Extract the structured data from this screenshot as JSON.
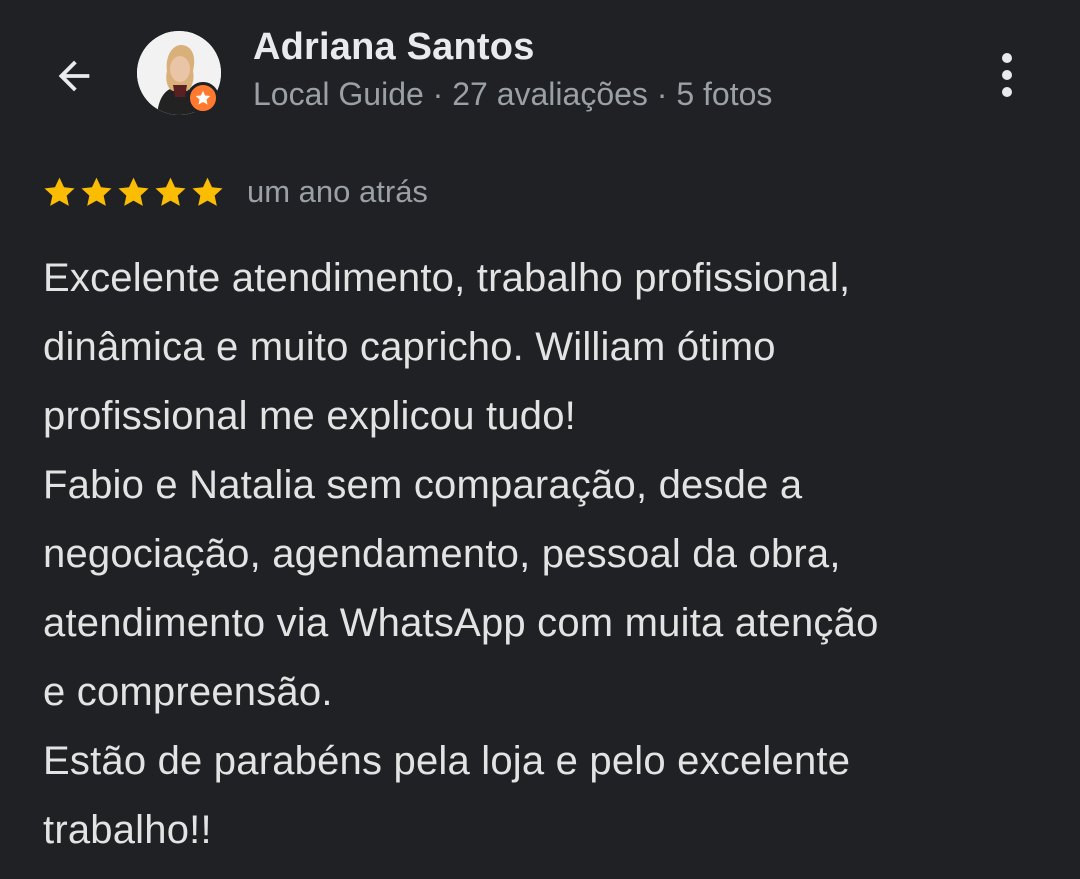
{
  "header": {
    "back_icon": "arrow-left-icon",
    "reviewer_name": "Adriana Santos",
    "reviewer_meta": "Local Guide · 27 avaliações · 5 fotos",
    "badge_icon": "local-guide-star-icon",
    "more_icon": "more-vert-icon"
  },
  "review": {
    "rating": 5,
    "rating_max": 5,
    "time": "um ano atrás",
    "lines": [
      "Excelente atendimento, trabalho profissional,",
      "dinâmica e muito capricho. William ótimo",
      "profissional me explicou tudo!",
      "Fabio e Natalia sem comparação, desde a",
      "negociação, agendamento, pessoal da obra,",
      "atendimento via WhatsApp com muita atenção",
      "e compreensão.",
      "Estão de parabéns pela loja e pelo excelente",
      "trabalho!!"
    ]
  },
  "colors": {
    "background": "#202124",
    "star": "#fbbc04",
    "badge": "#ff7a2e",
    "secondary_text": "#9aa0a6"
  }
}
